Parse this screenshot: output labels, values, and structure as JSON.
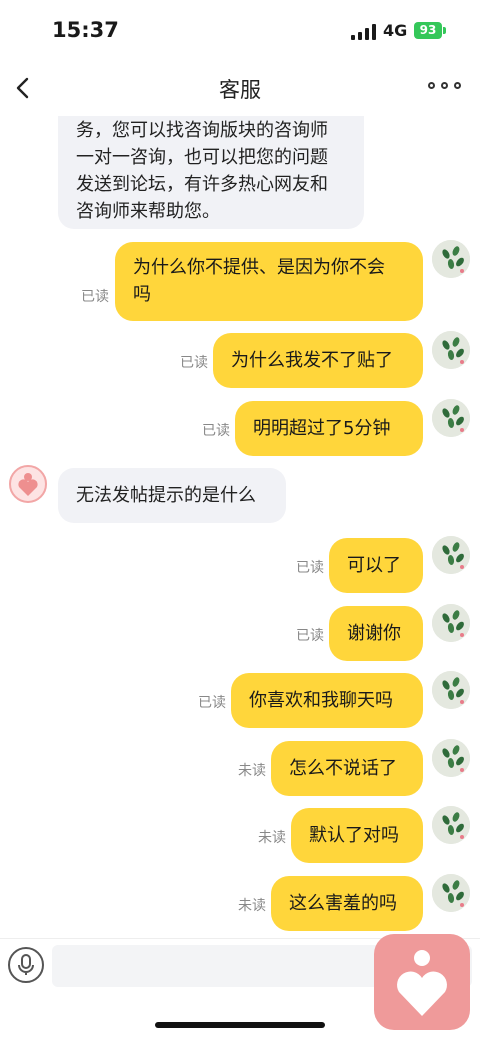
{
  "status": {
    "time": "15:37",
    "network": "4G",
    "battery": "93"
  },
  "header": {
    "title": "客服"
  },
  "messages": [
    {
      "side": "in",
      "lines": [
        "务，您可以找咨询版块的咨询师",
        "一对一咨询，也可以把您的问题",
        "发送到论坛，有许多热心网友和",
        "咨询师来帮助您。"
      ]
    },
    {
      "side": "out",
      "lines": [
        "为什么你不提供、是因为你不会",
        "吗"
      ],
      "status": "已读"
    },
    {
      "side": "out",
      "lines": [
        "为什么我发不了贴了"
      ],
      "status": "已读"
    },
    {
      "side": "out",
      "lines": [
        "明明超过了5分钟"
      ],
      "status": "已读"
    },
    {
      "side": "in",
      "lines": [
        "无法发帖提示的是什么"
      ]
    },
    {
      "side": "out",
      "lines": [
        "可以了"
      ],
      "status": "已读"
    },
    {
      "side": "out",
      "lines": [
        "谢谢你"
      ],
      "status": "已读"
    },
    {
      "side": "out",
      "lines": [
        "你喜欢和我聊天吗"
      ],
      "status": "已读"
    },
    {
      "side": "out",
      "lines": [
        "怎么不说话了"
      ],
      "status": "未读"
    },
    {
      "side": "out",
      "lines": [
        "默认了对吗"
      ],
      "status": "未读"
    },
    {
      "side": "out",
      "lines": [
        "这么害羞的吗"
      ],
      "status": "未读"
    }
  ],
  "input": {
    "placeholder": ""
  },
  "icons": {
    "back": "chevron-left-icon",
    "more": "more-dots-icon",
    "mic": "microphone-icon",
    "agent_avatar": "heart-avatar-icon",
    "float": "heart-app-icon"
  },
  "colors": {
    "outgoing_bubble": "#ffd63b",
    "incoming_bubble": "#f1f2f6",
    "float_button": "#ef9a9a",
    "battery": "#34c759"
  }
}
